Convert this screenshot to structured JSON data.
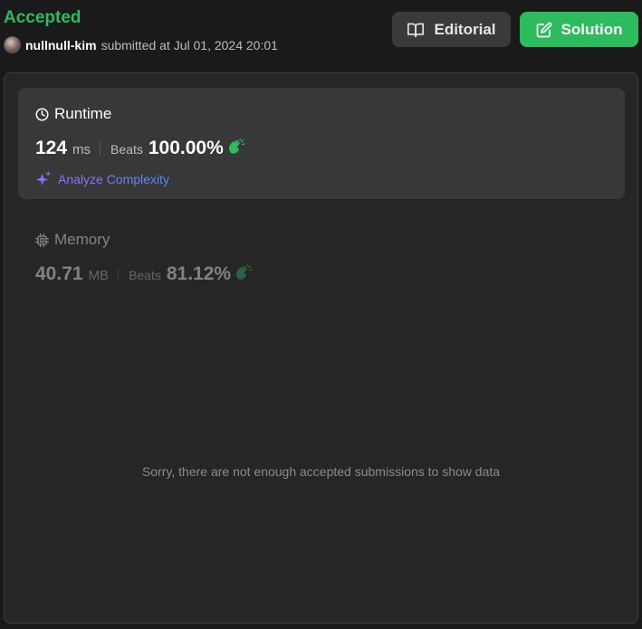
{
  "header": {
    "status": "Accepted",
    "username": "nullnull-kim",
    "submitted_text": "submitted at Jul 01, 2024 20:01"
  },
  "buttons": {
    "editorial": "Editorial",
    "solution": "Solution"
  },
  "runtime": {
    "title": "Runtime",
    "value": "124",
    "unit": "ms",
    "beats_label": "Beats",
    "beats_value": "100.00%",
    "analyze_label": "Analyze Complexity"
  },
  "memory": {
    "title": "Memory",
    "value": "40.71",
    "unit": "MB",
    "beats_label": "Beats",
    "beats_value": "81.12%"
  },
  "empty_message": "Sorry, there are not enough accepted submissions to show data",
  "icons": {
    "editorial": "book-open-icon",
    "solution": "edit-icon",
    "runtime": "clock-icon",
    "memory": "chip-icon",
    "analyze": "sparkle-icon",
    "beats": "clapping-hands-icon"
  },
  "colors": {
    "accepted": "#2cbb5d",
    "solution_button": "#2cbb5d",
    "clap": "#2cbb5d",
    "analyze_gradient_start": "#9b6cff",
    "analyze_gradient_end": "#4f8cff"
  }
}
